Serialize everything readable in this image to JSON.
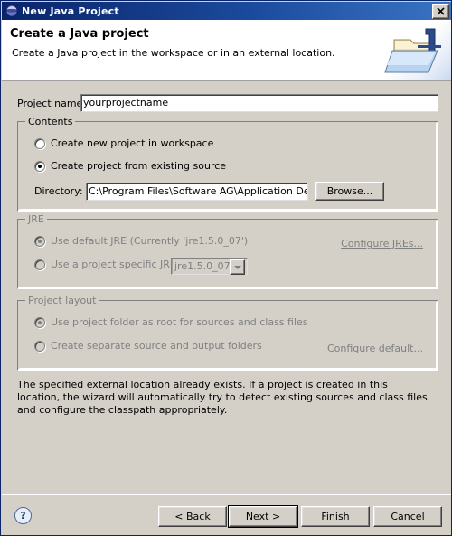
{
  "window": {
    "title": "New Java Project",
    "title_icon": "java-globe-icon",
    "close_label": "✕"
  },
  "header": {
    "title": "Create a Java project",
    "description": "Create a Java project in the workspace or in an external location.",
    "banner_icon": "java-project-folder-icon"
  },
  "form": {
    "project_name_label": "Project name:",
    "project_name_value": "yourprojectname",
    "project_name_placeholder": "",
    "contents": {
      "group_label": "Contents",
      "option_workspace": "Create new project in workspace",
      "option_existing": "Create project from existing source",
      "selected": "existing",
      "directory_label": "Directory:",
      "directory_value": "C:\\Program Files\\Software AG\\Application Designer\\tomcat\\w",
      "browse_label": "Browse..."
    },
    "jre": {
      "group_label": "JRE",
      "option_default": "Use default JRE (Currently 'jre1.5.0_07')",
      "option_specific": "Use a project specific JRE:",
      "selected": "default",
      "combo_value": "jre1.5.0_07",
      "configure_link": "Configure JREs...",
      "disabled": true
    },
    "layout": {
      "group_label": "Project layout",
      "option_root": "Use project folder as root for sources and class files",
      "option_separate": "Create separate source and output folders",
      "selected": "root",
      "configure_link": "Configure default...",
      "disabled": true
    }
  },
  "message": "The specified external location already exists. If a project is created in this location, the wizard will automatically try to detect existing sources and class files and configure the classpath appropriately.",
  "footer": {
    "help_icon": "help-question-icon",
    "help_glyph": "?",
    "back_label": "< Back",
    "next_label": "Next >",
    "finish_label": "Finish",
    "cancel_label": "Cancel",
    "default_button": "next"
  },
  "colors": {
    "dialog_bg": "#d4d0c8",
    "title_bar_start": "#0a246a",
    "title_bar_end": "#3a74c4",
    "disabled_text": "#808080",
    "field_bg": "#ffffff"
  }
}
